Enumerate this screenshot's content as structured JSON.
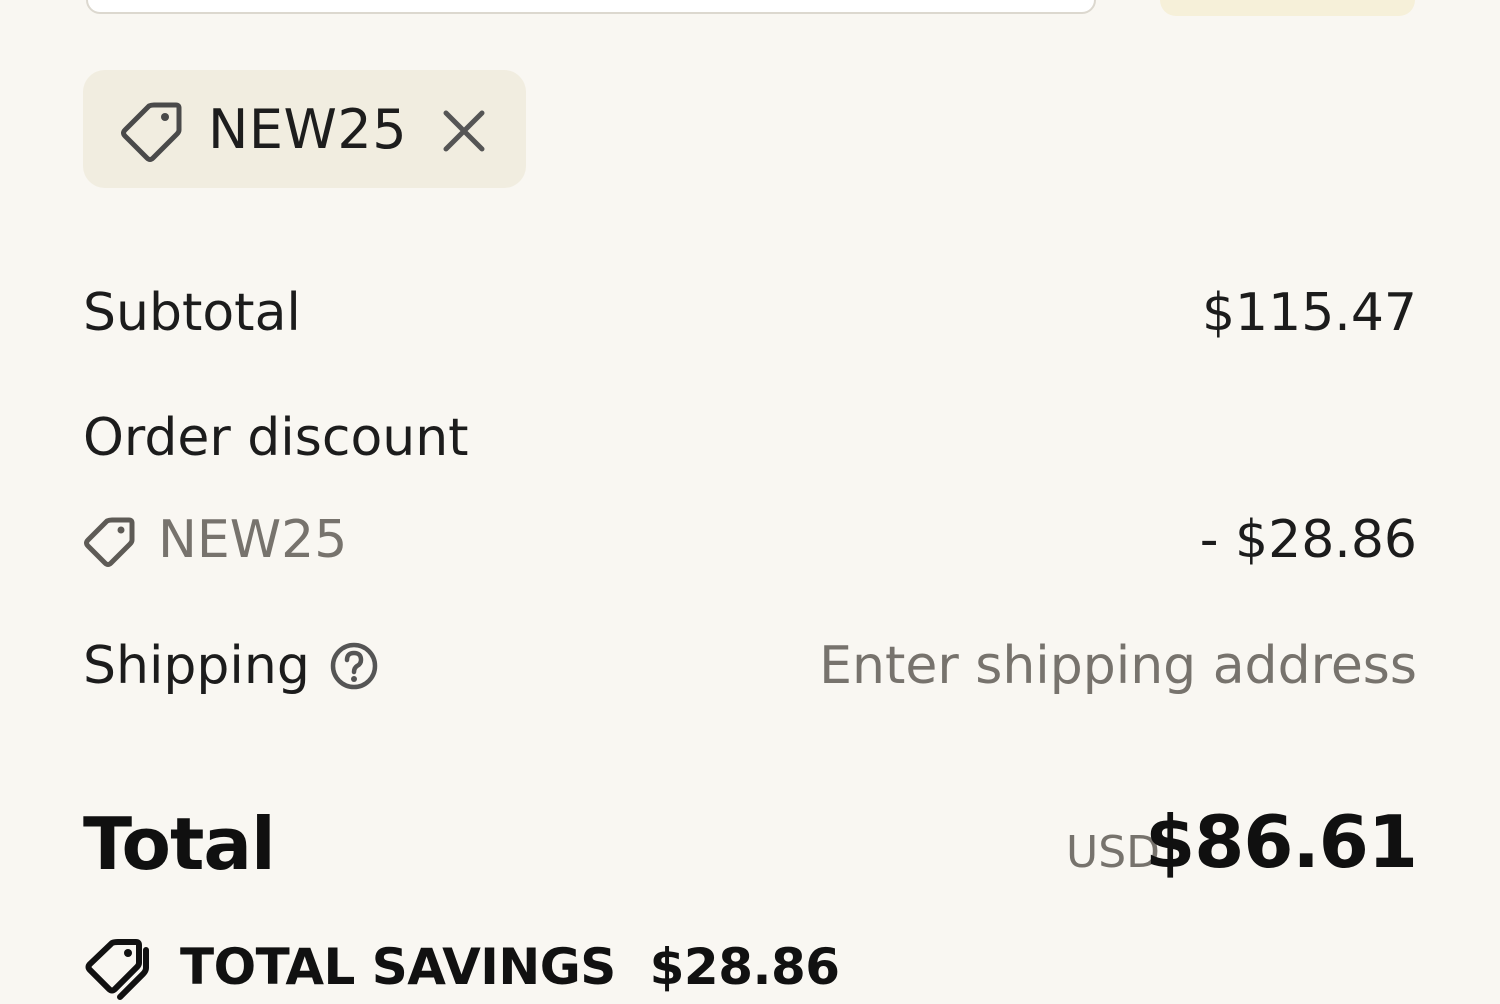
{
  "discount_chip": {
    "code": "NEW25",
    "tag_icon": "tag-icon",
    "remove_icon": "close-icon"
  },
  "summary": {
    "subtotal_label": "Subtotal",
    "subtotal_value": "$115.47",
    "order_discount_label": "Order discount",
    "discount_code": "NEW25",
    "discount_value": "- $28.86",
    "shipping_label": "Shipping",
    "shipping_help_icon": "help-circle-icon",
    "shipping_value": "Enter shipping address"
  },
  "total": {
    "label": "Total",
    "currency": "USD",
    "amount": "$86.61"
  },
  "savings": {
    "label": "TOTAL SAVINGS",
    "amount": "$28.86",
    "icon": "tags-icon"
  },
  "colors": {
    "background": "#f9f7f2",
    "chip_background": "#f1ede0",
    "text": "#1c1c1c",
    "muted_text": "#77736d"
  }
}
